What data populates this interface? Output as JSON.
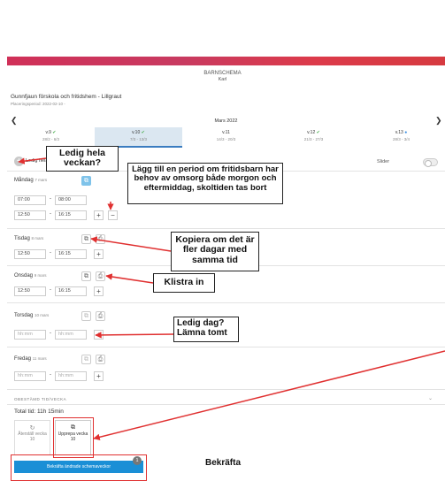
{
  "header": {
    "title": "BARNSCHEMA",
    "subtitle": "Karl"
  },
  "org": {
    "name": "Gunnfjaun förskola och fritidshem - Lillgraut",
    "period": "Placeringsperiod: 2022-02-10 -"
  },
  "nav": {
    "month": "Mars 2022",
    "prev_icon": "chevron-left-icon",
    "next_icon": "chevron-right-icon"
  },
  "weeks": [
    {
      "label": "v.9",
      "range": "28/2 - 6/3",
      "status": "check"
    },
    {
      "label": "v.10",
      "range": "7/3 - 13/3",
      "status": "check"
    },
    {
      "label": "v.11",
      "range": "14/3 - 20/3",
      "status": ""
    },
    {
      "label": "v.12",
      "range": "21/3 - 27/3",
      "status": "check"
    },
    {
      "label": "v.13",
      "range": "28/3 - 3/4",
      "status": "dot"
    }
  ],
  "ledig_week_label": "Ledig hela veckan",
  "slider_label": "Slider",
  "days": [
    {
      "name": "Måndag",
      "date": "7 mars",
      "rows": [
        {
          "from": "07:00",
          "to": "08:00"
        },
        {
          "from": "12:50",
          "to": "16:15"
        }
      ]
    },
    {
      "name": "Tisdag",
      "date": "8 mars",
      "rows": [
        {
          "from": "12:50",
          "to": "16:15"
        }
      ]
    },
    {
      "name": "Onsdag",
      "date": "9 mars",
      "rows": [
        {
          "from": "12:50",
          "to": "16:15"
        }
      ]
    },
    {
      "name": "Torsdag",
      "date": "10 mars",
      "rows": [
        {
          "from": "",
          "to": ""
        }
      ]
    },
    {
      "name": "Fredag",
      "date": "11 mars",
      "rows": [
        {
          "from": "",
          "to": ""
        }
      ]
    }
  ],
  "time_placeholder": "hh:mm",
  "obestamd_label": "OBESTÄMD TID/VECKA",
  "total_label": "Total tid: 11h 15min",
  "cards": {
    "reset": "Återställ vecka 10",
    "repeat": "Upprepa vecka 10"
  },
  "confirm": {
    "label": "Bekräfta ändrade schemaveckor",
    "badge": "1"
  },
  "callouts": {
    "ledig": "Ledig hela veckan?",
    "period": "Lägg till en period om fritidsbarn har behov av omsorg både morgon och eftermiddag, skoltiden tas bort",
    "kopiera": "Kopiera om det är fler dagar med samma tid",
    "klistra": "Klistra in",
    "ledigdag": "Ledig dag? Lämna tomt",
    "bekrafta": "Bekräfta"
  },
  "colors": {
    "accent": "#1a8fd6",
    "brand": "#d03058",
    "annotation": "#e03030"
  }
}
